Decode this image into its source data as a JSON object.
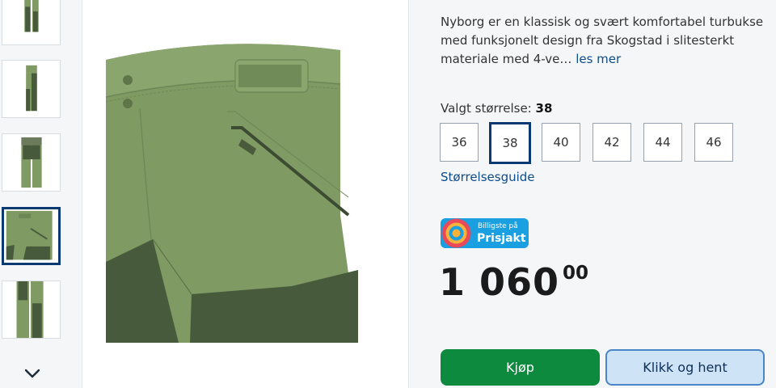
{
  "description": {
    "text": "Nyborg er en klassisk og svært komfortabel turbukse med funksjonelt design fra Skogstad i slitesterkt materiale med 4-ve…",
    "read_more": "les mer"
  },
  "size": {
    "label": "Valgt størrelse:",
    "selected": "38",
    "options": [
      "36",
      "38",
      "40",
      "42",
      "44",
      "46"
    ],
    "guide": "Størrelsesguide"
  },
  "badge": {
    "small": "Billigste på",
    "big": "Prisjakt"
  },
  "price": {
    "main": "1 060",
    "decimals": "00"
  },
  "buttons": {
    "buy": "Kjøp",
    "pickup": "Klikk og hent"
  },
  "icons": {
    "carousel_next": "chevron-down-icon"
  },
  "colors": {
    "primary_green": "#0e8a3e",
    "accent_blue": "#0b3a73",
    "link_blue": "#0f4c8a",
    "pickup_bg": "#cfe3f6",
    "prisjakt_blue": "#1a9fe0",
    "pant_olive": "#7f9a63",
    "pant_dark": "#485a3c"
  }
}
